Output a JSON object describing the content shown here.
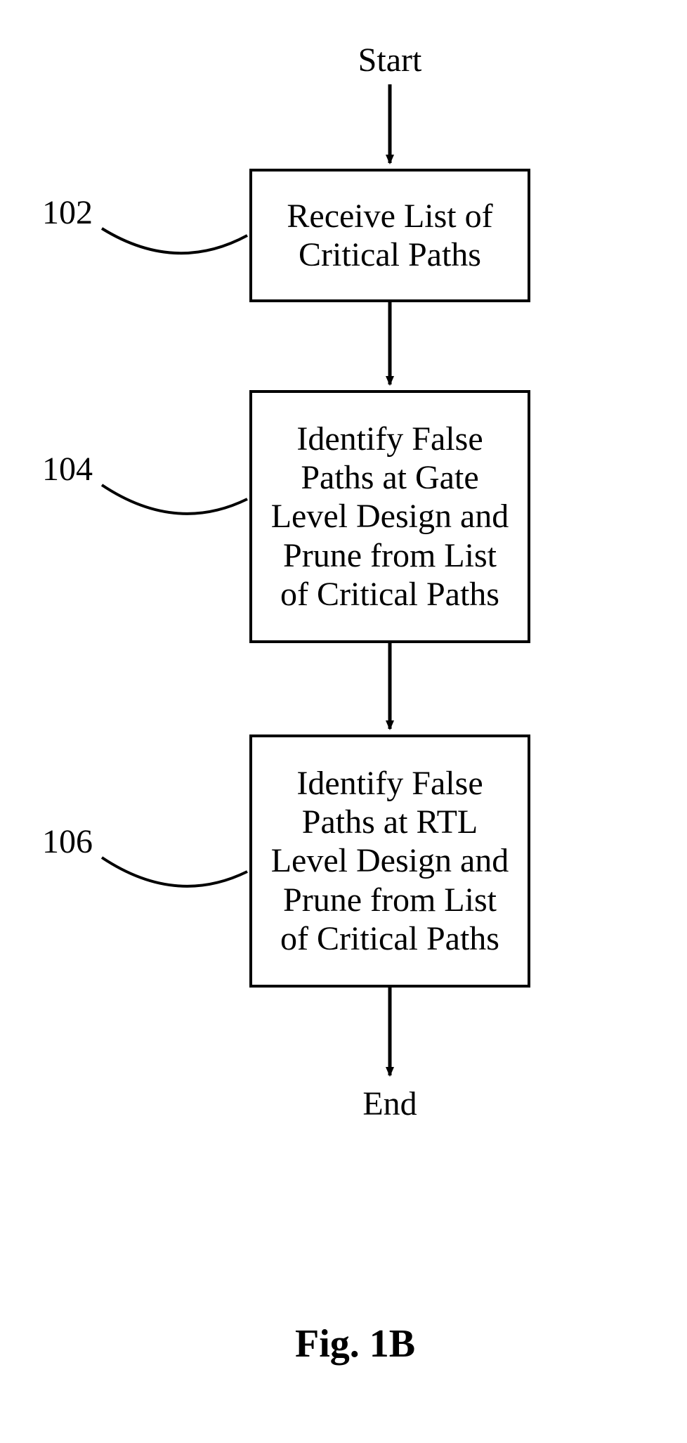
{
  "flow": {
    "start_label": "Start",
    "end_label": "End",
    "steps": [
      {
        "ref": "102",
        "text": "Receive List of Critical Paths"
      },
      {
        "ref": "104",
        "text": "Identify False Paths at Gate Level Design and Prune from List of Critical Paths"
      },
      {
        "ref": "106",
        "text": "Identify False Paths at RTL Level Design and Prune from List of Critical Paths"
      }
    ]
  },
  "figure_caption": "Fig. 1B"
}
